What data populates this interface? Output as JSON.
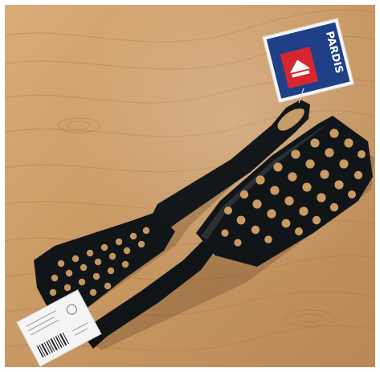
{
  "image": {
    "subject": "two-black-slotted-spatulas-on-wood-table"
  },
  "colors": {
    "wood_light": "#d9b07c",
    "wood_mid": "#c89a66",
    "wood_dark": "#a87444",
    "spatula": "#111417",
    "spatula_highlight": "#2c3034",
    "tag_blue": "#1f3f87",
    "tag_red": "#d7262e",
    "label_white": "#f4f4f4"
  },
  "brand_tag": {
    "lettering": "PARDIS"
  }
}
